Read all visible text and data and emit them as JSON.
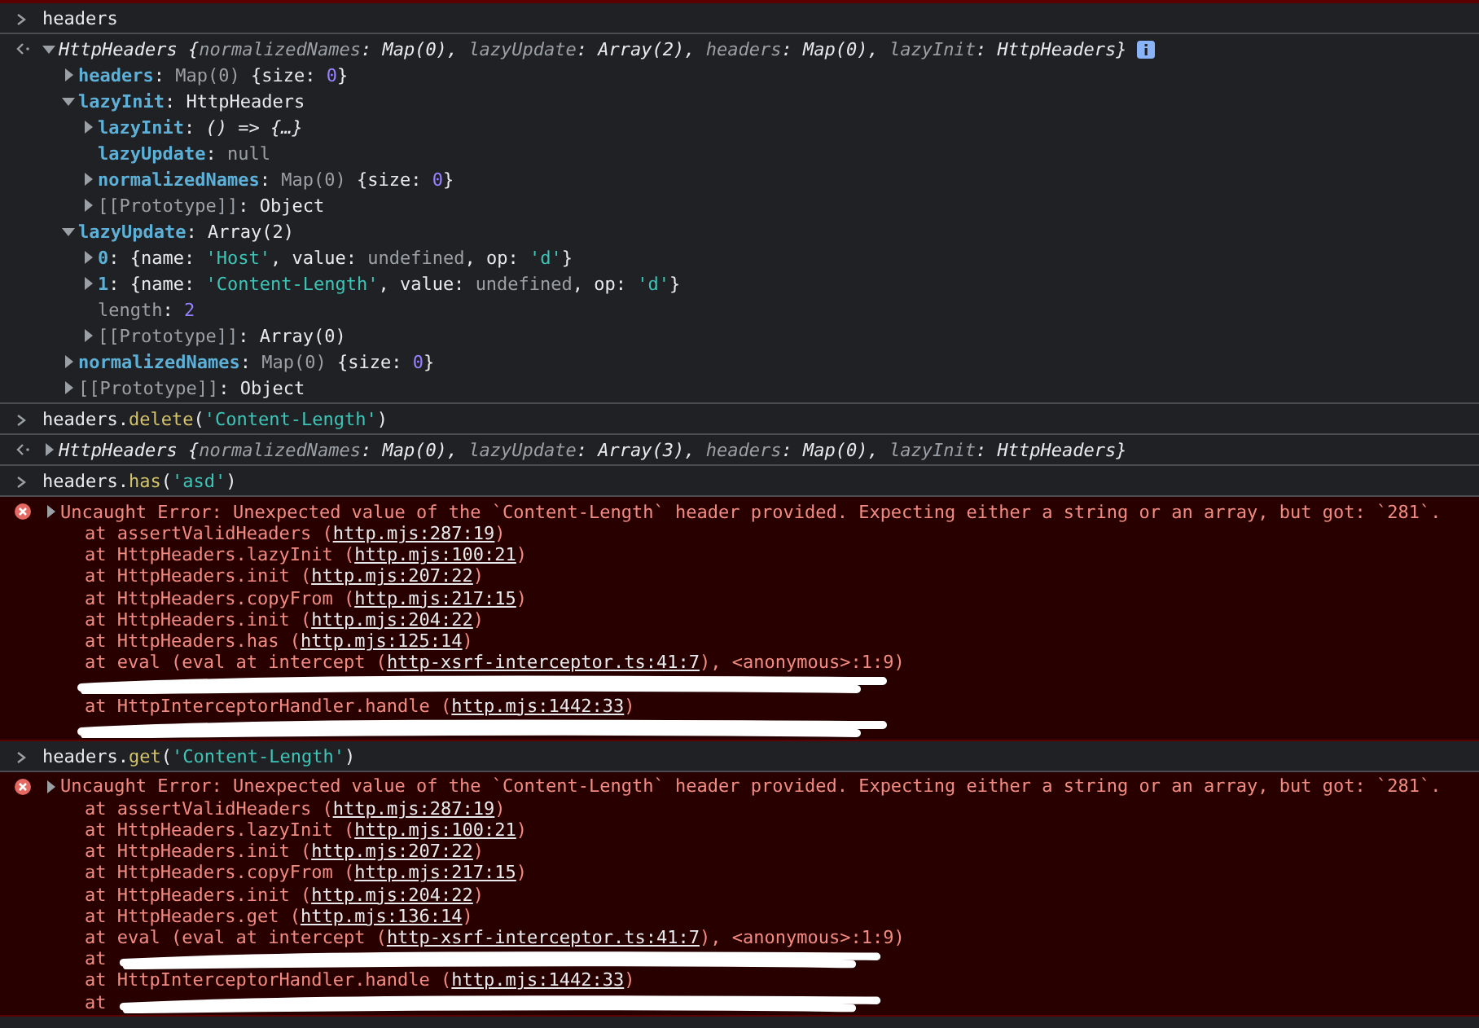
{
  "entries": [
    {
      "kind": "input",
      "parts": [
        {
          "text": "headers",
          "kind": "text"
        }
      ]
    },
    {
      "kind": "result",
      "expanded": true,
      "info_badge": true,
      "preview": [
        {
          "text": "HttpHeaders ",
          "kind": "text"
        },
        {
          "text": "{",
          "kind": "text"
        },
        {
          "text": "normalizedNames",
          "kind": "dim"
        },
        {
          "text": ": Map(0), ",
          "kind": "text"
        },
        {
          "text": "lazyUpdate",
          "kind": "dim"
        },
        {
          "text": ": Array(2), ",
          "kind": "text"
        },
        {
          "text": "headers",
          "kind": "dim"
        },
        {
          "text": ": Map(0), ",
          "kind": "text"
        },
        {
          "text": "lazyInit",
          "kind": "dim"
        },
        {
          "text": ": HttpHeaders}",
          "kind": "text"
        }
      ],
      "children": [
        {
          "key": "headers",
          "enumerable": true,
          "expanded": false,
          "value": [
            {
              "text": ": ",
              "kind": "text"
            },
            {
              "text": "Map(0) ",
              "kind": "dim"
            },
            {
              "text": "{size: ",
              "kind": "text"
            },
            {
              "text": "0",
              "kind": "number"
            },
            {
              "text": "}",
              "kind": "text"
            }
          ]
        },
        {
          "key": "lazyInit",
          "enumerable": true,
          "expanded": true,
          "value": [
            {
              "text": ": HttpHeaders",
              "kind": "text"
            }
          ],
          "children": [
            {
              "key": "lazyInit",
              "enumerable": true,
              "expanded": false,
              "value": [
                {
                  "text": ": ",
                  "kind": "text"
                },
                {
                  "text": "() => {…}",
                  "kind": "italic"
                }
              ]
            },
            {
              "key": "lazyUpdate",
              "enumerable": true,
              "value": [
                {
                  "text": ": ",
                  "kind": "text"
                },
                {
                  "text": "null",
                  "kind": "dim"
                }
              ]
            },
            {
              "key": "normalizedNames",
              "enumerable": true,
              "expanded": false,
              "value": [
                {
                  "text": ": ",
                  "kind": "text"
                },
                {
                  "text": "Map(0) ",
                  "kind": "dim"
                },
                {
                  "text": "{size: ",
                  "kind": "text"
                },
                {
                  "text": "0",
                  "kind": "number"
                },
                {
                  "text": "}",
                  "kind": "text"
                }
              ]
            },
            {
              "key": "[[Prototype]]",
              "enumerable": false,
              "expanded": false,
              "value": [
                {
                  "text": ": Object",
                  "kind": "text"
                }
              ]
            }
          ]
        },
        {
          "key": "lazyUpdate",
          "enumerable": true,
          "expanded": true,
          "value": [
            {
              "text": ": Array(2)",
              "kind": "text"
            }
          ],
          "children": [
            {
              "key": "0",
              "enumerable": true,
              "expanded": false,
              "value": [
                {
                  "text": ": {name: ",
                  "kind": "text"
                },
                {
                  "text": "'Host'",
                  "kind": "string"
                },
                {
                  "text": ", value: ",
                  "kind": "text"
                },
                {
                  "text": "undefined",
                  "kind": "dim"
                },
                {
                  "text": ", op: ",
                  "kind": "text"
                },
                {
                  "text": "'d'",
                  "kind": "string"
                },
                {
                  "text": "}",
                  "kind": "text"
                }
              ]
            },
            {
              "key": "1",
              "enumerable": true,
              "expanded": false,
              "value": [
                {
                  "text": ": {name: ",
                  "kind": "text"
                },
                {
                  "text": "'Content-Length'",
                  "kind": "string"
                },
                {
                  "text": ", value: ",
                  "kind": "text"
                },
                {
                  "text": "undefined",
                  "kind": "dim"
                },
                {
                  "text": ", op: ",
                  "kind": "text"
                },
                {
                  "text": "'d'",
                  "kind": "string"
                },
                {
                  "text": "}",
                  "kind": "text"
                }
              ]
            },
            {
              "key": "length",
              "enumerable": false,
              "value": [
                {
                  "text": ": ",
                  "kind": "text"
                },
                {
                  "text": "2",
                  "kind": "number"
                }
              ]
            },
            {
              "key": "[[Prototype]]",
              "enumerable": false,
              "expanded": false,
              "value": [
                {
                  "text": ": Array(0)",
                  "kind": "text"
                }
              ]
            }
          ]
        },
        {
          "key": "normalizedNames",
          "enumerable": true,
          "expanded": false,
          "value": [
            {
              "text": ": ",
              "kind": "text"
            },
            {
              "text": "Map(0) ",
              "kind": "dim"
            },
            {
              "text": "{size: ",
              "kind": "text"
            },
            {
              "text": "0",
              "kind": "number"
            },
            {
              "text": "}",
              "kind": "text"
            }
          ]
        },
        {
          "key": "[[Prototype]]",
          "enumerable": false,
          "expanded": false,
          "value": [
            {
              "text": ": Object",
              "kind": "text"
            }
          ]
        }
      ]
    },
    {
      "kind": "input",
      "parts": [
        {
          "text": "headers.",
          "kind": "text"
        },
        {
          "text": "delete",
          "kind": "method"
        },
        {
          "text": "(",
          "kind": "text"
        },
        {
          "text": "'Content-Length'",
          "kind": "string"
        },
        {
          "text": ")",
          "kind": "text"
        }
      ]
    },
    {
      "kind": "result",
      "expanded": false,
      "preview": [
        {
          "text": "HttpHeaders ",
          "kind": "text"
        },
        {
          "text": "{",
          "kind": "text"
        },
        {
          "text": "normalizedNames",
          "kind": "dim"
        },
        {
          "text": ": Map(0), ",
          "kind": "text"
        },
        {
          "text": "lazyUpdate",
          "kind": "dim"
        },
        {
          "text": ": Array(3), ",
          "kind": "text"
        },
        {
          "text": "headers",
          "kind": "dim"
        },
        {
          "text": ": Map(0), ",
          "kind": "text"
        },
        {
          "text": "lazyInit",
          "kind": "dim"
        },
        {
          "text": ": HttpHeaders}",
          "kind": "text"
        }
      ]
    },
    {
      "kind": "input",
      "parts": [
        {
          "text": "headers.",
          "kind": "text"
        },
        {
          "text": "has",
          "kind": "method"
        },
        {
          "text": "(",
          "kind": "text"
        },
        {
          "text": "'asd'",
          "kind": "string"
        },
        {
          "text": ")",
          "kind": "text"
        }
      ]
    },
    {
      "kind": "error",
      "expanded": false,
      "message": "Uncaught Error: Unexpected value of the `Content-Length` header provided. Expecting either a string or an array, but got: `281`.",
      "stack": [
        {
          "kind": "frame",
          "prefix": "at assertValidHeaders (",
          "link": "http.mjs:287:19",
          "suffix": ")"
        },
        {
          "kind": "frame",
          "prefix": "at HttpHeaders.lazyInit (",
          "link": "http.mjs:100:21",
          "suffix": ")"
        },
        {
          "kind": "frame",
          "prefix": "at HttpHeaders.init (",
          "link": "http.mjs:207:22",
          "suffix": ")"
        },
        {
          "kind": "frame",
          "prefix": "at HttpHeaders.copyFrom (",
          "link": "http.mjs:217:15",
          "suffix": ")"
        },
        {
          "kind": "frame",
          "prefix": "at HttpHeaders.init (",
          "link": "http.mjs:204:22",
          "suffix": ")"
        },
        {
          "kind": "frame",
          "prefix": "at HttpHeaders.has (",
          "link": "http.mjs:125:14",
          "suffix": ")"
        },
        {
          "kind": "frame",
          "prefix": "at eval (eval at intercept (",
          "link": "http-xsrf-interceptor.ts:41:7",
          "suffix": "), <anonymous>:1:9)"
        },
        {
          "kind": "redacted"
        },
        {
          "kind": "frame",
          "prefix": "at HttpInterceptorHandler.handle (",
          "link": "http.mjs:1442:33",
          "suffix": ")"
        },
        {
          "kind": "redacted"
        }
      ]
    },
    {
      "kind": "input",
      "parts": [
        {
          "text": "headers.",
          "kind": "text"
        },
        {
          "text": "get",
          "kind": "method"
        },
        {
          "text": "(",
          "kind": "text"
        },
        {
          "text": "'Content-Length'",
          "kind": "string"
        },
        {
          "text": ")",
          "kind": "text"
        }
      ]
    },
    {
      "kind": "error",
      "expanded": false,
      "message": "Uncaught Error: Unexpected value of the `Content-Length` header provided. Expecting either a string or an array, but got: `281`.",
      "stack": [
        {
          "kind": "frame",
          "prefix": "at assertValidHeaders (",
          "link": "http.mjs:287:19",
          "suffix": ")"
        },
        {
          "kind": "frame",
          "prefix": "at HttpHeaders.lazyInit (",
          "link": "http.mjs:100:21",
          "suffix": ")"
        },
        {
          "kind": "frame",
          "prefix": "at HttpHeaders.init (",
          "link": "http.mjs:207:22",
          "suffix": ")"
        },
        {
          "kind": "frame",
          "prefix": "at HttpHeaders.copyFrom (",
          "link": "http.mjs:217:15",
          "suffix": ")"
        },
        {
          "kind": "frame",
          "prefix": "at HttpHeaders.init (",
          "link": "http.mjs:204:22",
          "suffix": ")"
        },
        {
          "kind": "frame",
          "prefix": "at HttpHeaders.get (",
          "link": "http.mjs:136:14",
          "suffix": ")"
        },
        {
          "kind": "frame",
          "prefix": "at eval (eval at intercept (",
          "link": "http-xsrf-interceptor.ts:41:7",
          "suffix": "), <anonymous>:1:9)"
        },
        {
          "kind": "redacted",
          "prefix": "at"
        },
        {
          "kind": "frame",
          "prefix": "at HttpInterceptorHandler.handle (",
          "link": "http.mjs:1442:33",
          "suffix": ")"
        },
        {
          "kind": "redacted",
          "prefix": "at"
        }
      ]
    }
  ]
}
